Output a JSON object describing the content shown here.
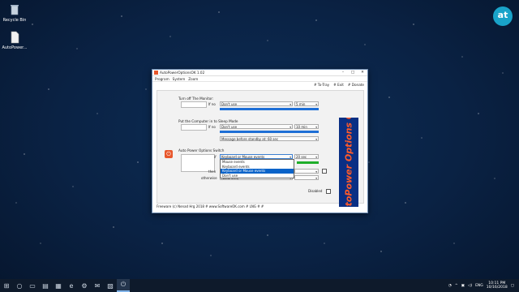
{
  "desktop": {
    "icons": [
      {
        "label": "Recycle Bin",
        "icon": "recycle-bin-icon"
      },
      {
        "label": "AutoPower...",
        "icon": "file-icon"
      }
    ],
    "brand_logo": "at"
  },
  "window": {
    "title": "AutoPowerOptionsOK 1.02",
    "menu": [
      "Program",
      "System",
      "Zoom"
    ],
    "top_links": [
      "# To-Tray",
      "# Exit",
      "# Donate"
    ],
    "sections": {
      "monitor": {
        "title": "Turn off The Monitor:",
        "if_label": "If no",
        "event_value": "Don't use",
        "time_value": "5 min"
      },
      "sleep": {
        "title": "Put the Computer in to Sleep Mode",
        "if_label": "If no",
        "event_value": "Don't use",
        "time_value": "10 min",
        "message_value": "Message before standby at: 60 sec"
      },
      "switch": {
        "title": "Auto Power Options Switch",
        "if_label": "if",
        "event_value": "Keyboard or Mouse events",
        "time_value": "20 sec",
        "then_label": "then",
        "otherwise_label": "otherwise",
        "otherwise_value": "(balanced)",
        "dropdown_options": [
          "Mouse events",
          "Keyboard events",
          "Keyboard or Mouse events",
          "Don't use"
        ],
        "selected_option": "Keyboard or Mouse events"
      }
    },
    "banner_text": "AutoPower Options OK",
    "disabled_label": "Disabled",
    "footer": "Freeware (c) Nenad Hrg 2018 # www.SoftwareOK.com   # LNG   #   #"
  },
  "taskbar": {
    "time": "10:11 PM",
    "date": "10/16/2018",
    "lang": "ENG"
  },
  "colors": {
    "progress_blue": "#1e6fd6",
    "progress_green": "#1fae2a",
    "banner_bg": "#0a2f84",
    "banner_text": "#ff5a2a"
  }
}
